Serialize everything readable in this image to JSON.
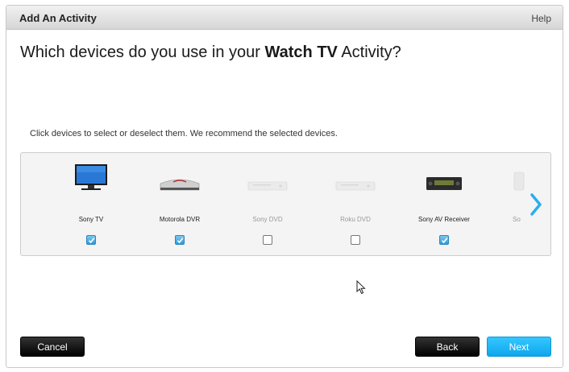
{
  "window": {
    "title": "Add An Activity",
    "help_label": "Help"
  },
  "question": {
    "prefix": "Which devices do you use in your ",
    "activity": "Watch TV",
    "suffix": " Activity?"
  },
  "instructions": "Click devices to select or deselect them. We recommend the selected devices.",
  "devices": [
    {
      "label": "Sony TV",
      "selected": true,
      "icon": "tv-icon"
    },
    {
      "label": "Motorola DVR",
      "selected": true,
      "icon": "dvr-icon"
    },
    {
      "label": "Sony DVD",
      "selected": false,
      "icon": "dvd-player-icon"
    },
    {
      "label": "Roku DVD",
      "selected": false,
      "icon": "dvd-player-icon"
    },
    {
      "label": "Sony AV Receiver",
      "selected": true,
      "icon": "av-receiver-icon"
    },
    {
      "label": "So",
      "selected": false,
      "icon": "device-icon"
    }
  ],
  "colors": {
    "accent": "#1aa9ec",
    "checked": "#2f9bd9",
    "dark_button": "#111111"
  },
  "buttons": {
    "cancel": "Cancel",
    "back": "Back",
    "next": "Next"
  }
}
